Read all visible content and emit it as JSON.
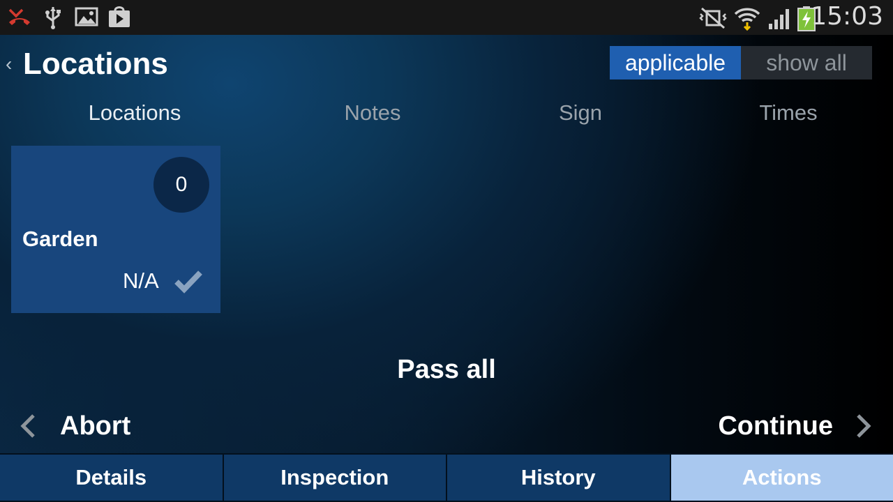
{
  "status_bar": {
    "time": "15:03",
    "icons": [
      "missed-call-icon",
      "usb-icon",
      "gallery-icon",
      "play-store-icon",
      "vibrate-mute-icon",
      "wifi-icon",
      "signal-icon",
      "battery-charging-icon"
    ]
  },
  "header": {
    "back_glyph": "‹",
    "title": "Locations",
    "filter": {
      "options": [
        "applicable",
        "show all"
      ],
      "selected": "applicable"
    }
  },
  "tabs": [
    {
      "label": "Locations",
      "active": true
    },
    {
      "label": "Notes",
      "active": false
    },
    {
      "label": "Sign",
      "active": false
    },
    {
      "label": "Times",
      "active": false
    }
  ],
  "locations": [
    {
      "name": "Garden",
      "count": "0",
      "status": "N/A",
      "check_icon": "check-icon"
    }
  ],
  "actions": {
    "pass_all": "Pass all",
    "abort": "Abort",
    "continue": "Continue"
  },
  "bottom_nav": [
    {
      "label": "Details",
      "active": false
    },
    {
      "label": "Inspection",
      "active": false
    },
    {
      "label": "History",
      "active": false
    },
    {
      "label": "Actions",
      "active": true
    }
  ],
  "colors": {
    "accent": "#1f5fb0",
    "tile": "#18467d",
    "nav_active": "#a9c8ef",
    "nav": "#0f3966"
  }
}
